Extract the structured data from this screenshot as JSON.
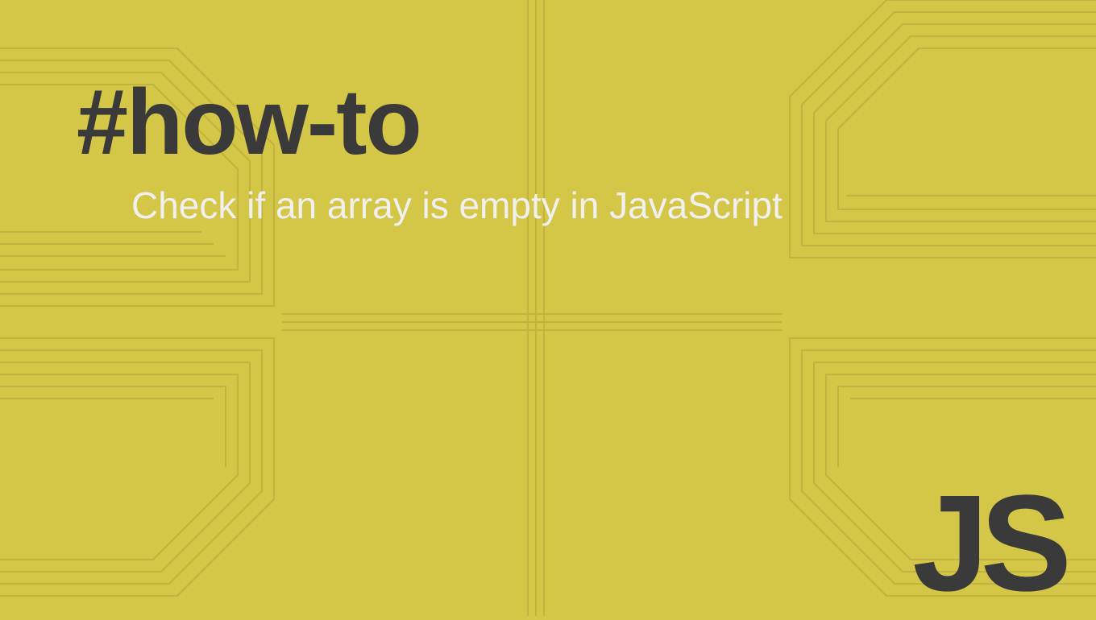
{
  "heading": "#how-to",
  "subtitle": "Check if an array is empty in JavaScript",
  "logo": "JS",
  "colors": {
    "background": "#d4c646",
    "heading": "#3a3a3a",
    "subtitle": "#f0f0f0",
    "circuit": "#c0b33e"
  }
}
